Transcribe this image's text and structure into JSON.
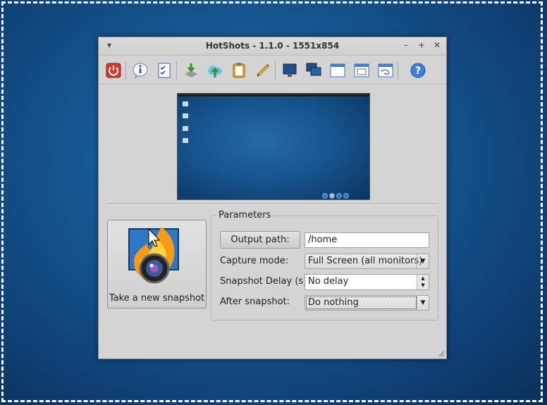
{
  "window": {
    "title": "HotShots - 1.1.0 - 1551x854",
    "menu_icon": "triangle-down-icon",
    "minimize_icon": "minimize-icon",
    "maximize_icon": "maximize-icon",
    "close_icon": "close-icon"
  },
  "toolbar": {
    "items": [
      "quit-icon",
      "about-icon",
      "tasks-icon",
      "save-icon",
      "upload-icon",
      "clipboard-icon",
      "edit-icon",
      "screen-icon",
      "all-screens-icon",
      "window-icon",
      "region-icon",
      "freehand-icon",
      "help-icon"
    ]
  },
  "snapshot_button": {
    "label": "Take a new snapshot"
  },
  "parameters": {
    "title": "Parameters",
    "output_path_button": "Output path:",
    "output_path_value": "/home",
    "capture_mode_label": "Capture mode:",
    "capture_mode_value": "Full Screen (all monitors)",
    "delay_label": "Snapshot Delay (s):",
    "delay_value": "No delay",
    "after_label": "After snapshot:",
    "after_value": "Do nothing"
  },
  "colors": {
    "desktop": "#175a95",
    "window_bg": "#d4d4d4",
    "selection_border": "#ffffff"
  }
}
